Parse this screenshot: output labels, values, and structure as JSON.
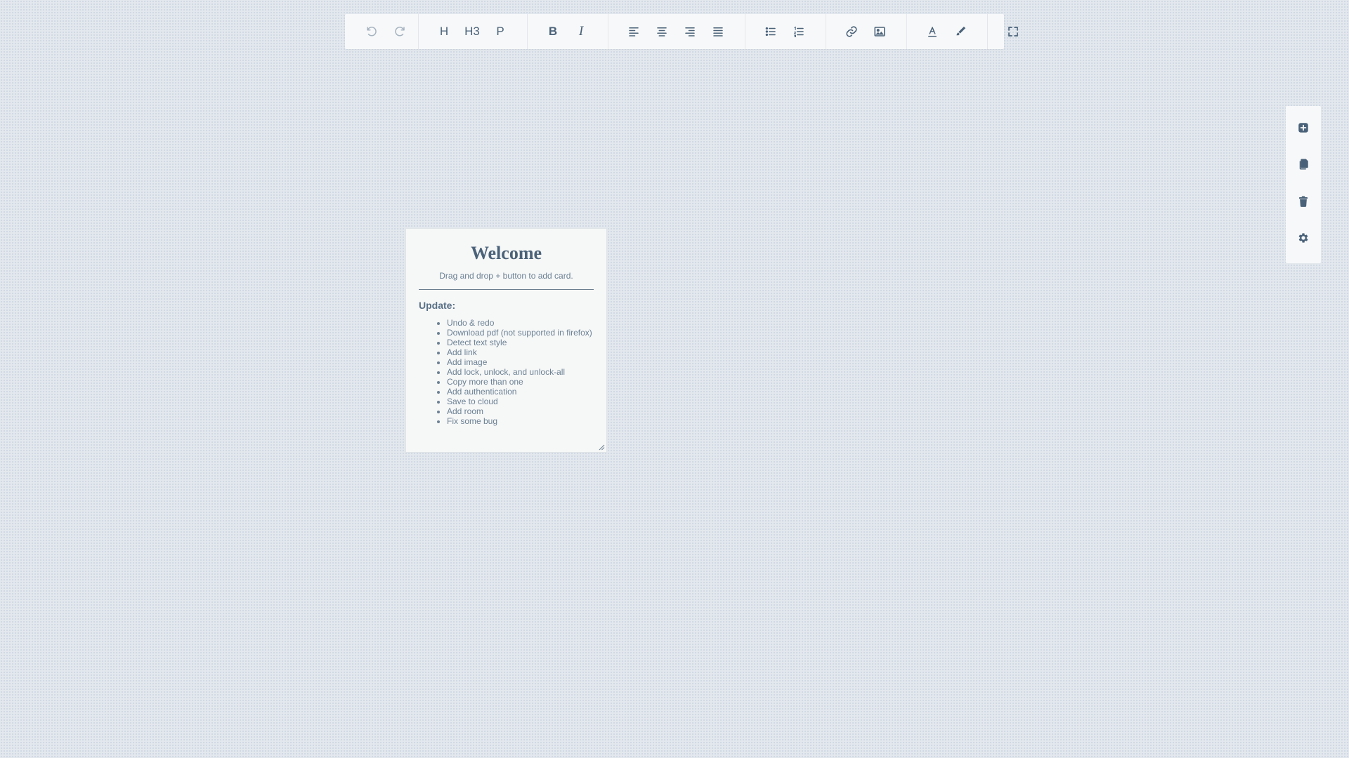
{
  "toolbar": {
    "undo_icon": "undo-icon",
    "redo_icon": "redo-icon",
    "heading_label": "H",
    "h3_label": "H3",
    "paragraph_label": "P",
    "bold_label": "B",
    "italic_label": "I",
    "align_left_icon": "align-left-icon",
    "align_center_icon": "align-center-icon",
    "align_right_icon": "align-right-icon",
    "align_justify_icon": "align-justify-icon",
    "bullet_list_icon": "bullet-list-icon",
    "numbered_list_icon": "numbered-list-icon",
    "link_icon": "link-icon",
    "image_icon": "image-icon",
    "text_color_icon": "text-color-icon",
    "highlight_icon": "highlight-icon",
    "fullscreen_icon": "fullscreen-icon"
  },
  "side_panel": {
    "add_icon": "plus-icon",
    "copy_icon": "copy-icon",
    "delete_icon": "trash-icon",
    "settings_icon": "gear-icon"
  },
  "card": {
    "title": "Welcome",
    "subtitle": "Drag and drop + button to add card.",
    "update_label": "Update:",
    "items": [
      "Undo & redo",
      "Download pdf (not supported in firefox)",
      "Detect text style",
      "Add link",
      "Add image",
      "Add lock, unlock, and unlock-all",
      "Copy more than one",
      "Add authentication",
      "Save to cloud",
      "Add room",
      "Fix some bug"
    ]
  },
  "colors": {
    "background": "#e3e8ee",
    "panel": "#f7f8f9",
    "text": "#4a6279",
    "disabled": "#a6b3c0"
  }
}
